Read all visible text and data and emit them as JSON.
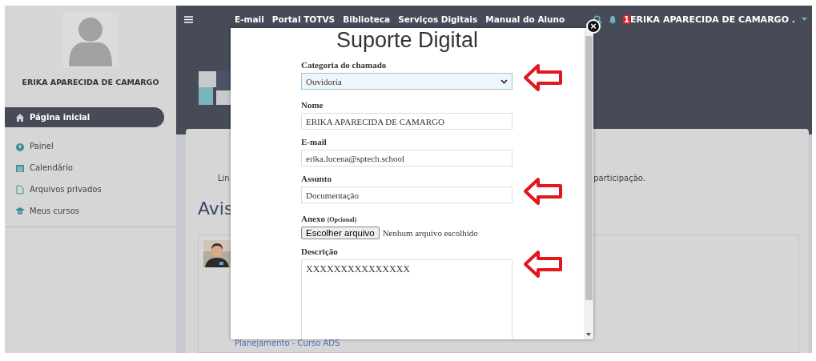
{
  "sidebar": {
    "user_name": "ERIKA APARECIDA DE CAMARGO",
    "items": [
      {
        "label": "Página inicial",
        "selected": true
      },
      {
        "label": "Painel",
        "selected": false
      },
      {
        "label": "Calendário",
        "selected": false
      },
      {
        "label": "Arquivos privados",
        "selected": false
      },
      {
        "label": "Meus cursos",
        "selected": false
      }
    ]
  },
  "navbar": {
    "links": [
      "E-mail",
      "Portal TOTVS",
      "Biblioteca",
      "Serviços Digitais",
      "Manual do Aluno"
    ],
    "notification_count": "1",
    "user": "ERIKA APARECIDA DE CAMARGO ."
  },
  "page": {
    "text_start": "Lin",
    "text_end": "participação.",
    "heading": "Avis",
    "post": {
      "link": "Planejamento - Curso ADS"
    }
  },
  "modal": {
    "close": "×",
    "title": "Suporte Digital",
    "fields": [
      {
        "kind": "select",
        "label": "Categoria do chamado",
        "value": "Ouvidoria",
        "annotated": true
      },
      {
        "kind": "text",
        "label": "Nome",
        "value": "ERIKA APARECIDA DE CAMARGO",
        "annotated": false
      },
      {
        "kind": "text",
        "label": "E-mail",
        "value": "erika.lucena@sptech.school",
        "annotated": false
      },
      {
        "kind": "text",
        "label": "Assunto",
        "value": "Documentação",
        "annotated": true
      },
      {
        "kind": "file",
        "label": "Anexo",
        "hint": "(Opcional)",
        "button": "Escolher arquivo",
        "value": "Nenhum arquivo escolhido",
        "annotated": false
      },
      {
        "kind": "textarea",
        "label": "Descrição",
        "value": "XXXXXXXXXXXXXXX",
        "annotated": true
      }
    ]
  }
}
